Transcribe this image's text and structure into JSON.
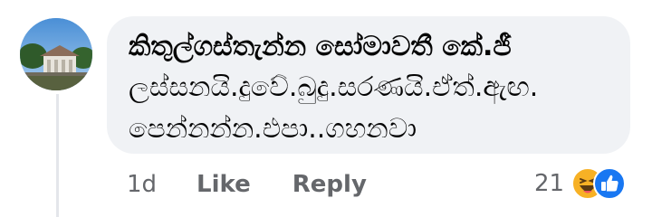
{
  "comment": {
    "author": "කිතුල්ගස්තැන්න සෝමාවතී කේ.ජී",
    "text": "ලස්සනයි.දුවේ.බුදු.සරණයි.ඒත්.ඇඟ.\nපෙන්නන්න.එපා..ගහනවා",
    "avatar_icon": "avatar-temple-photo"
  },
  "actions": {
    "timestamp": "1d",
    "like_label": "Like",
    "reply_label": "Reply"
  },
  "reactions": {
    "count": "21",
    "icons": [
      "haha-icon",
      "like-icon"
    ],
    "colors": {
      "haha": "#f7b125",
      "like": "#1877f2"
    }
  },
  "colors": {
    "bubble": "#f0f2f5",
    "secondary_text": "#65676b",
    "primary_text": "#050505"
  }
}
